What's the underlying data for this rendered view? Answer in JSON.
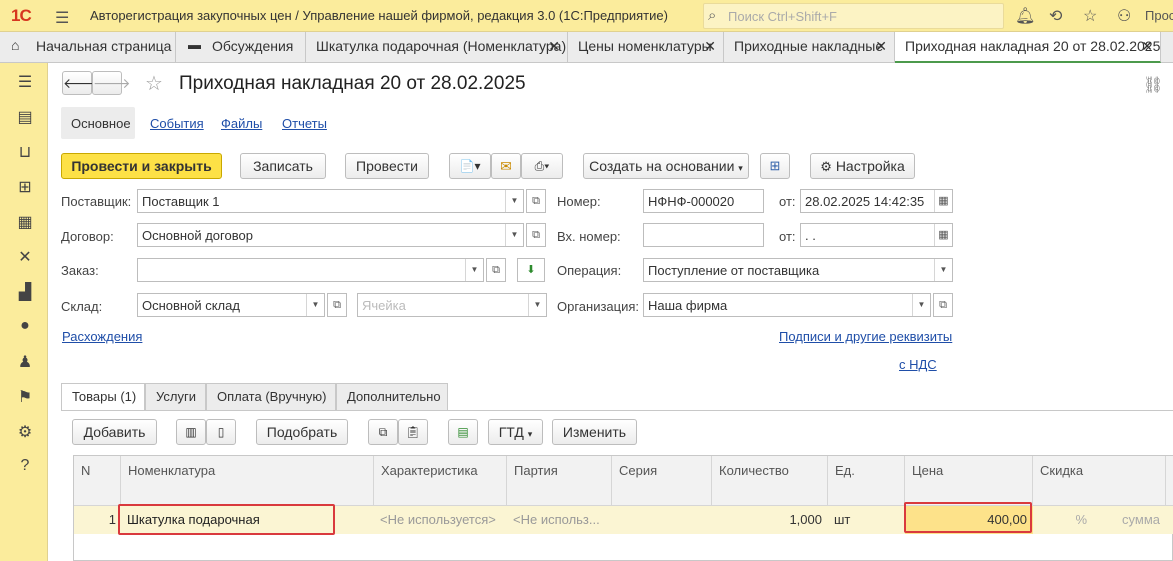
{
  "header": {
    "logo": "1С",
    "title": "Авторегистрация закупочных цен / Управление нашей фирмой, редакция 3.0  (1С:Предприятие)",
    "search_placeholder": "Поиск Ctrl+Shift+F"
  },
  "tabs": [
    {
      "label": "Начальная страница"
    },
    {
      "label": "Обсуждения"
    },
    {
      "label": "Шкатулка подарочная (Номенклатура)"
    },
    {
      "label": "Цены номенклатуры"
    },
    {
      "label": "Приходные накладные"
    },
    {
      "label": "Приходная накладная 20 от 28.02.2025"
    }
  ],
  "doc": {
    "title": "Приходная накладная 20 от 28.02.2025",
    "sections": [
      "Основное",
      "События",
      "Файлы",
      "Отчеты"
    ],
    "toolbar": {
      "post_close": "Провести и закрыть",
      "save": "Записать",
      "post": "Провести",
      "create_based": "Создать на основании",
      "settings": "Настройка"
    },
    "fields": {
      "supplier_label": "Поставщик:",
      "supplier": "Поставщик 1",
      "contract_label": "Договор:",
      "contract": "Основной договор",
      "order_label": "Заказ:",
      "order": "",
      "warehouse_label": "Склад:",
      "warehouse": "Основной склад",
      "cell_placeholder": "Ячейка",
      "number_label": "Номер:",
      "number": "НФНФ-000020",
      "from_label": "от:",
      "date": "28.02.2025 14:42:35",
      "in_number_label": "Вх. номер:",
      "in_number": "",
      "in_date": " .  .",
      "operation_label": "Операция:",
      "operation": "Поступление от поставщика",
      "org_label": "Организация:",
      "org": "Наша фирма"
    },
    "links": {
      "discrepancies": "Расхождения",
      "signatures": "Подписи и другие реквизиты",
      "vat": "с НДС"
    },
    "page_tabs": [
      "Товары (1)",
      "Услуги",
      "Оплата (Вручную)",
      "Дополнительно"
    ],
    "table_toolbar": {
      "add": "Добавить",
      "pick": "Подобрать",
      "gtd": "ГТД",
      "change": "Изменить"
    },
    "columns": [
      "N",
      "Номенклатура",
      "Характеристика",
      "Партия",
      "Серия",
      "Количество",
      "Ед.",
      "Цена",
      "Скидка"
    ],
    "rows": [
      {
        "n": "1",
        "item": "Шкатулка подарочная",
        "characteristic": "<Не используется>",
        "batch": "<Не использ...",
        "series": "",
        "qty": "1,000",
        "unit": "шт",
        "price": "400,00",
        "discount": "%",
        "sum": "сумма"
      }
    ]
  }
}
